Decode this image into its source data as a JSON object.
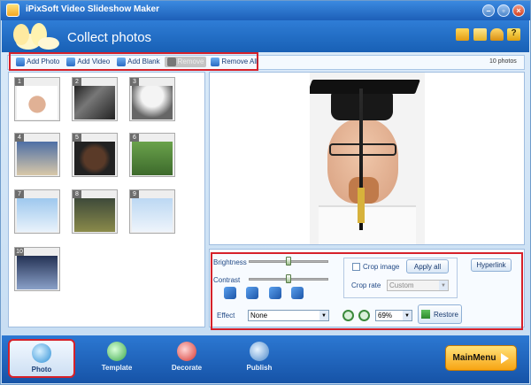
{
  "app": {
    "title": "iPixSoft Video Slideshow Maker"
  },
  "header": {
    "title": "Collect photos"
  },
  "toolbar": {
    "add_photo": "Add Photo",
    "add_video": "Add Video",
    "add_blank": "Add Blank",
    "remove": "Remove",
    "remove_all": "Remove All",
    "photo_count": "10 photos"
  },
  "thumbnails": [
    "1",
    "2",
    "3",
    "4",
    "5",
    "6",
    "7",
    "8",
    "9",
    "10"
  ],
  "controls": {
    "brightness_label": "Brightness",
    "contrast_label": "Contrast",
    "brightness_value": 0.5,
    "contrast_value": 0.5,
    "effect_label": "Effect",
    "effect_value": "None",
    "crop_image_label": "Crop image",
    "crop_image_checked": false,
    "apply_all": "Apply all",
    "crop_rate_label": "Crop rate",
    "crop_rate_value": "Custom",
    "hyperlink": "Hyperlink",
    "zoom_value": "69%",
    "restore": "Restore"
  },
  "tabs": [
    {
      "label": "Photo",
      "active": true
    },
    {
      "label": "Template",
      "active": false
    },
    {
      "label": "Decorate",
      "active": false
    },
    {
      "label": "Publish",
      "active": false
    }
  ],
  "main_menu": "MainMenu",
  "colors": {
    "accent": "#1d5fb8",
    "highlight": "#d6212a",
    "menu": "#f7a413"
  }
}
